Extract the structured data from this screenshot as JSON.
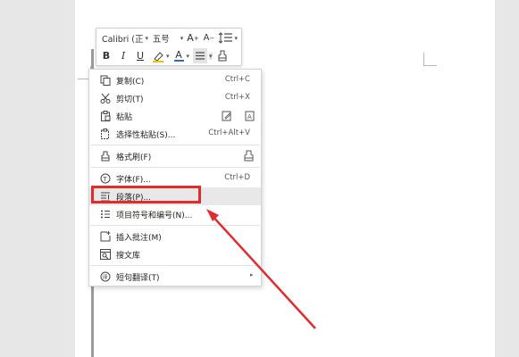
{
  "toolbar": {
    "font_name": "Calibri (正",
    "font_size": "五号",
    "bold_label": "B",
    "italic_label": "I",
    "underline_label": "U",
    "grow_font_label": "A",
    "shrink_font_label": "A",
    "font_color_label": "A",
    "font_color": "#3366cc"
  },
  "context_menu": {
    "items": [
      {
        "label": "复制(C)",
        "shortcut": "Ctrl+C",
        "icon": "copy-icon"
      },
      {
        "label": "剪切(T)",
        "shortcut": "Ctrl+X",
        "icon": "scissors-icon"
      },
      {
        "label": "粘贴",
        "shortcut": "",
        "icon": "paste-icon"
      },
      {
        "label": "选择性粘贴(S)...",
        "shortcut": "Ctrl+Alt+V",
        "icon": "paste-special-icon"
      },
      {
        "label": "格式刷(F)",
        "shortcut": "",
        "icon": "format-painter-icon"
      },
      {
        "label": "字体(F)...",
        "shortcut": "Ctrl+D",
        "icon": "font-icon"
      },
      {
        "label": "段落(P)...",
        "shortcut": "",
        "icon": "paragraph-icon"
      },
      {
        "label": "项目符号和编号(N)...",
        "shortcut": "",
        "icon": "bullets-icon"
      },
      {
        "label": "插入批注(M)",
        "shortcut": "",
        "icon": "comment-icon"
      },
      {
        "label": "搜文库",
        "shortcut": "",
        "icon": "search-library-icon"
      },
      {
        "label": "短句翻译(T)",
        "shortcut": "",
        "icon": "translate-icon"
      }
    ]
  },
  "colors": {
    "highlight_red": "#e02c2c",
    "accent_blue": "#3366cc"
  }
}
